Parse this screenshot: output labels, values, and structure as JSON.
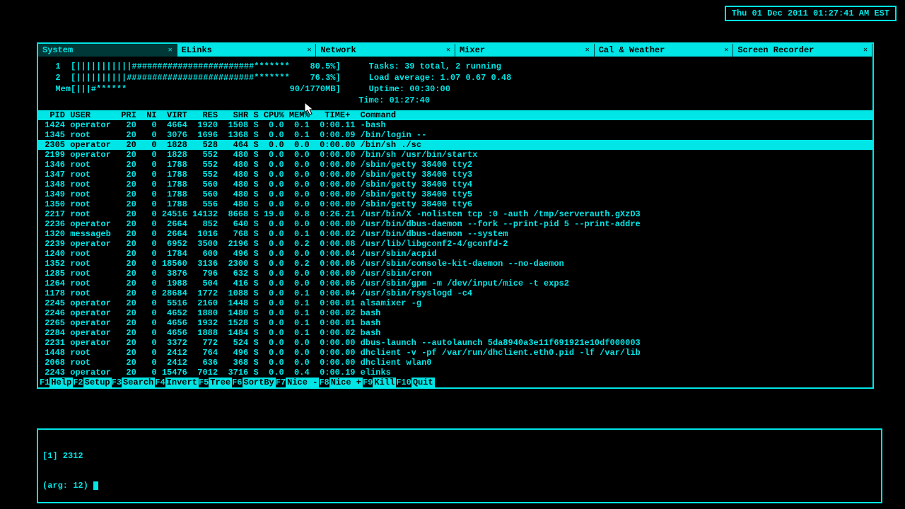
{
  "clock": "Thu 01 Dec 2011 01:27:41 AM EST",
  "tabs": [
    {
      "label": "System",
      "active": true
    },
    {
      "label": "ELinks",
      "active": false
    },
    {
      "label": "Network",
      "active": false
    },
    {
      "label": "Mixer",
      "active": false
    },
    {
      "label": "Cal & Weather",
      "active": false
    },
    {
      "label": "Screen Recorder",
      "active": false
    }
  ],
  "meters": {
    "cpu1": "  1  [|||||||||||########################*******    80.5%]",
    "cpu2": "  2  [||||||||||#########################*******    76.3%]",
    "mem": "  Mem[|||#******                                90/1770MB]",
    "tasks": "Tasks: 39 total, 2 running",
    "load": "Load average: 1.07 0.67 0.48",
    "uptime": "Uptime: 00:30:00",
    "time": "Time: 01:27:40"
  },
  "columns": "  PID USER      PRI  NI  VIRT   RES   SHR S CPU% MEM%   TIME+  Command",
  "selected_pid": 2305,
  "rows": [
    {
      "pid": 1424,
      "user": "operator",
      "pri": 20,
      "ni": 0,
      "virt": "4664",
      "res": "1920",
      "shr": "1508",
      "s": "S",
      "cpu": "0.0",
      "mem": "0.1",
      "time": "0:00.11",
      "cmd": "-bash"
    },
    {
      "pid": 1345,
      "user": "root",
      "pri": 20,
      "ni": 0,
      "virt": "3076",
      "res": "1696",
      "shr": "1368",
      "s": "S",
      "cpu": "0.0",
      "mem": "0.1",
      "time": "0:00.09",
      "cmd": "/bin/login --"
    },
    {
      "pid": 2305,
      "user": "operator",
      "pri": 20,
      "ni": 0,
      "virt": "1828",
      "res": "528",
      "shr": "464",
      "s": "S",
      "cpu": "0.0",
      "mem": "0.0",
      "time": "0:00.00",
      "cmd": "/bin/sh ./sc"
    },
    {
      "pid": 2199,
      "user": "operator",
      "pri": 20,
      "ni": 0,
      "virt": "1828",
      "res": "552",
      "shr": "480",
      "s": "S",
      "cpu": "0.0",
      "mem": "0.0",
      "time": "0:00.00",
      "cmd": "/bin/sh /usr/bin/startx"
    },
    {
      "pid": 1346,
      "user": "root",
      "pri": 20,
      "ni": 0,
      "virt": "1788",
      "res": "552",
      "shr": "480",
      "s": "S",
      "cpu": "0.0",
      "mem": "0.0",
      "time": "0:00.00",
      "cmd": "/sbin/getty 38400 tty2"
    },
    {
      "pid": 1347,
      "user": "root",
      "pri": 20,
      "ni": 0,
      "virt": "1788",
      "res": "552",
      "shr": "480",
      "s": "S",
      "cpu": "0.0",
      "mem": "0.0",
      "time": "0:00.00",
      "cmd": "/sbin/getty 38400 tty3"
    },
    {
      "pid": 1348,
      "user": "root",
      "pri": 20,
      "ni": 0,
      "virt": "1788",
      "res": "560",
      "shr": "480",
      "s": "S",
      "cpu": "0.0",
      "mem": "0.0",
      "time": "0:00.00",
      "cmd": "/sbin/getty 38400 tty4"
    },
    {
      "pid": 1349,
      "user": "root",
      "pri": 20,
      "ni": 0,
      "virt": "1788",
      "res": "560",
      "shr": "480",
      "s": "S",
      "cpu": "0.0",
      "mem": "0.0",
      "time": "0:00.00",
      "cmd": "/sbin/getty 38400 tty5"
    },
    {
      "pid": 1350,
      "user": "root",
      "pri": 20,
      "ni": 0,
      "virt": "1788",
      "res": "556",
      "shr": "480",
      "s": "S",
      "cpu": "0.0",
      "mem": "0.0",
      "time": "0:00.00",
      "cmd": "/sbin/getty 38400 tty6"
    },
    {
      "pid": 2217,
      "user": "root",
      "pri": 20,
      "ni": 0,
      "virt": "24516",
      "res": "14132",
      "shr": "8668",
      "s": "S",
      "cpu": "19.0",
      "mem": "0.8",
      "time": "0:26.21",
      "cmd": "/usr/bin/X -nolisten tcp :0 -auth /tmp/serverauth.gXzD3"
    },
    {
      "pid": 2236,
      "user": "operator",
      "pri": 20,
      "ni": 0,
      "virt": "2664",
      "res": "852",
      "shr": "640",
      "s": "S",
      "cpu": "0.0",
      "mem": "0.0",
      "time": "0:00.00",
      "cmd": "/usr/bin/dbus-daemon --fork --print-pid 5 --print-addre"
    },
    {
      "pid": 1320,
      "user": "messageb",
      "pri": 20,
      "ni": 0,
      "virt": "2664",
      "res": "1016",
      "shr": "768",
      "s": "S",
      "cpu": "0.0",
      "mem": "0.1",
      "time": "0:00.02",
      "cmd": "/usr/bin/dbus-daemon --system"
    },
    {
      "pid": 2239,
      "user": "operator",
      "pri": 20,
      "ni": 0,
      "virt": "6952",
      "res": "3500",
      "shr": "2196",
      "s": "S",
      "cpu": "0.0",
      "mem": "0.2",
      "time": "0:00.08",
      "cmd": "/usr/lib/libgconf2-4/gconfd-2"
    },
    {
      "pid": 1240,
      "user": "root",
      "pri": 20,
      "ni": 0,
      "virt": "1784",
      "res": "600",
      "shr": "496",
      "s": "S",
      "cpu": "0.0",
      "mem": "0.0",
      "time": "0:00.04",
      "cmd": "/usr/sbin/acpid"
    },
    {
      "pid": 1352,
      "user": "root",
      "pri": 20,
      "ni": 0,
      "virt": "18560",
      "res": "3136",
      "shr": "2300",
      "s": "S",
      "cpu": "0.0",
      "mem": "0.2",
      "time": "0:00.06",
      "cmd": "/usr/sbin/console-kit-daemon --no-daemon"
    },
    {
      "pid": 1285,
      "user": "root",
      "pri": 20,
      "ni": 0,
      "virt": "3876",
      "res": "796",
      "shr": "632",
      "s": "S",
      "cpu": "0.0",
      "mem": "0.0",
      "time": "0:00.00",
      "cmd": "/usr/sbin/cron"
    },
    {
      "pid": 1264,
      "user": "root",
      "pri": 20,
      "ni": 0,
      "virt": "1988",
      "res": "504",
      "shr": "416",
      "s": "S",
      "cpu": "0.0",
      "mem": "0.0",
      "time": "0:00.06",
      "cmd": "/usr/sbin/gpm -m /dev/input/mice -t exps2"
    },
    {
      "pid": 1178,
      "user": "root",
      "pri": 20,
      "ni": 0,
      "virt": "28684",
      "res": "1772",
      "shr": "1088",
      "s": "S",
      "cpu": "0.0",
      "mem": "0.1",
      "time": "0:00.04",
      "cmd": "/usr/sbin/rsyslogd -c4"
    },
    {
      "pid": 2245,
      "user": "operator",
      "pri": 20,
      "ni": 0,
      "virt": "5516",
      "res": "2160",
      "shr": "1448",
      "s": "S",
      "cpu": "0.0",
      "mem": "0.1",
      "time": "0:00.01",
      "cmd": "alsamixer -g"
    },
    {
      "pid": 2246,
      "user": "operator",
      "pri": 20,
      "ni": 0,
      "virt": "4652",
      "res": "1880",
      "shr": "1480",
      "s": "S",
      "cpu": "0.0",
      "mem": "0.1",
      "time": "0:00.02",
      "cmd": "bash"
    },
    {
      "pid": 2265,
      "user": "operator",
      "pri": 20,
      "ni": 0,
      "virt": "4656",
      "res": "1932",
      "shr": "1528",
      "s": "S",
      "cpu": "0.0",
      "mem": "0.1",
      "time": "0:00.01",
      "cmd": "bash"
    },
    {
      "pid": 2284,
      "user": "operator",
      "pri": 20,
      "ni": 0,
      "virt": "4656",
      "res": "1888",
      "shr": "1484",
      "s": "S",
      "cpu": "0.0",
      "mem": "0.1",
      "time": "0:00.02",
      "cmd": "bash"
    },
    {
      "pid": 2231,
      "user": "operator",
      "pri": 20,
      "ni": 0,
      "virt": "3372",
      "res": "772",
      "shr": "524",
      "s": "S",
      "cpu": "0.0",
      "mem": "0.0",
      "time": "0:00.00",
      "cmd": "dbus-launch --autolaunch 5da8940a3e11f691921e10df000003"
    },
    {
      "pid": 1448,
      "user": "root",
      "pri": 20,
      "ni": 0,
      "virt": "2412",
      "res": "764",
      "shr": "496",
      "s": "S",
      "cpu": "0.0",
      "mem": "0.0",
      "time": "0:00.00",
      "cmd": "dhclient -v -pf /var/run/dhclient.eth0.pid -lf /var/lib"
    },
    {
      "pid": 2068,
      "user": "root",
      "pri": 20,
      "ni": 0,
      "virt": "2412",
      "res": "636",
      "shr": "368",
      "s": "S",
      "cpu": "0.0",
      "mem": "0.0",
      "time": "0:00.00",
      "cmd": "dhclient wlan0"
    },
    {
      "pid": 2243,
      "user": "operator",
      "pri": 20,
      "ni": 0,
      "virt": "15476",
      "res": "7012",
      "shr": "3716",
      "s": "S",
      "cpu": "0.0",
      "mem": "0.4",
      "time": "0:00.19",
      "cmd": "elinks"
    }
  ],
  "fkeys": [
    {
      "k": "F1",
      "l": "Help"
    },
    {
      "k": "F2",
      "l": "Setup"
    },
    {
      "k": "F3",
      "l": "Search"
    },
    {
      "k": "F4",
      "l": "Invert"
    },
    {
      "k": "F5",
      "l": "Tree"
    },
    {
      "k": "F6",
      "l": "SortBy"
    },
    {
      "k": "F7",
      "l": "Nice -"
    },
    {
      "k": "F8",
      "l": "Nice +"
    },
    {
      "k": "F9",
      "l": "Kill"
    },
    {
      "k": "F10",
      "l": "Quit"
    }
  ],
  "prompt": {
    "line1": "[1] 2312",
    "line2": "(arg: 12) "
  }
}
